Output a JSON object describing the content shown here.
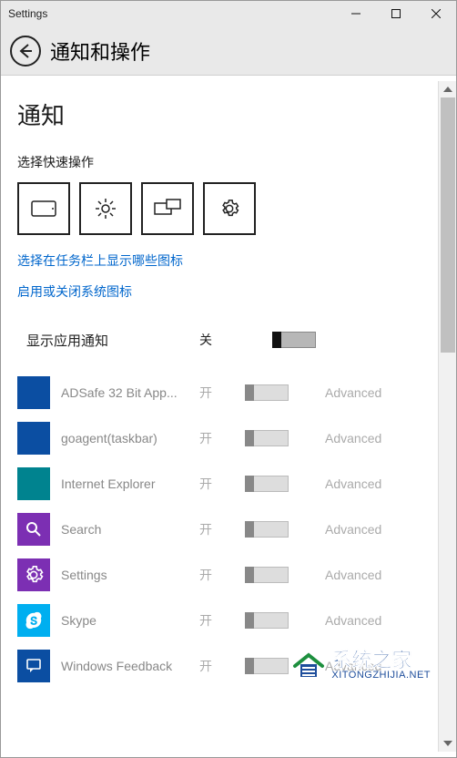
{
  "window": {
    "title": "Settings"
  },
  "page": {
    "title": "通知和操作"
  },
  "section": {
    "heading": "通知",
    "quick_actions_label": "选择快速操作"
  },
  "links": {
    "choose_taskbar_icons": "选择在任务栏上显示哪些图标",
    "toggle_system_icons": "启用或关闭系统图标"
  },
  "app_notifications": {
    "label": "显示应用通知",
    "state": "关"
  },
  "advanced_label": "Advanced",
  "state_on": "开",
  "apps": [
    {
      "name": "ADSafe 32 Bit App...",
      "icon": "blue-square",
      "state": "开"
    },
    {
      "name": "goagent(taskbar)",
      "icon": "blue-square",
      "state": "开"
    },
    {
      "name": "Internet Explorer",
      "icon": "teal-square",
      "state": "开"
    },
    {
      "name": "Search",
      "icon": "search",
      "state": "开"
    },
    {
      "name": "Settings",
      "icon": "settings",
      "state": "开"
    },
    {
      "name": "Skype",
      "icon": "skype",
      "state": "开"
    },
    {
      "name": "Windows Feedback",
      "icon": "feedback",
      "state": "开"
    }
  ],
  "watermark": {
    "zh": "系统之家",
    "en": "XITONGZHIJIA.NET"
  }
}
